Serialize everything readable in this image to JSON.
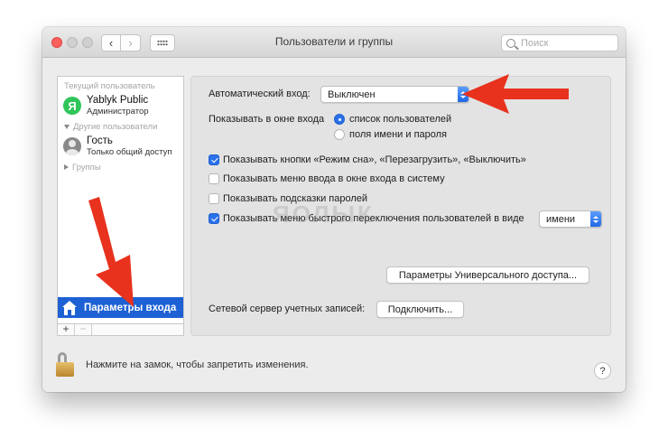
{
  "window": {
    "title": "Пользователи и группы"
  },
  "search": {
    "placeholder": "Поиск"
  },
  "sidebar": {
    "current_user_header": "Текущий пользователь",
    "current_user": {
      "initial": "Я",
      "name": "Yablyk Public",
      "role": "Администратор"
    },
    "other_users_header": "Другие пользователи",
    "other_users": [
      {
        "name": "Гость",
        "role": "Только общий доступ"
      }
    ],
    "groups_header": "Группы",
    "selected_item": "Параметры входа",
    "add_label": "+",
    "remove_label": "−"
  },
  "panel": {
    "auto_login_label": "Автоматический вход:",
    "auto_login_value": "Выключен",
    "show_in_login_label": "Показывать в окне входа",
    "radio_options": [
      {
        "label": "список пользователей",
        "selected": true
      },
      {
        "label": "поля имени и пароля",
        "selected": false
      }
    ],
    "checkboxes": [
      {
        "label": "Показывать кнопки «Режим сна», «Перезагрузить», «Выключить»",
        "checked": true
      },
      {
        "label": "Показывать меню ввода в окне входа в систему",
        "checked": false
      },
      {
        "label": "Показывать подсказки паролей",
        "checked": false
      },
      {
        "label": "Показывать меню быстрого переключения пользователей в виде",
        "checked": true
      }
    ],
    "fast_switch_value": "имени",
    "accessibility_button": "Параметры Универсального доступа...",
    "network_server_label": "Сетевой сервер учетных записей:",
    "connect_button": "Подключить..."
  },
  "footer": {
    "lock_text": "Нажмите на замок, чтобы запретить изменения.",
    "help_label": "?"
  },
  "watermark": "ЯОЛЫК",
  "colors": {
    "selection": "#1d61d4",
    "accent": "#2a71ea",
    "annotation_arrow": "#e8321e"
  }
}
